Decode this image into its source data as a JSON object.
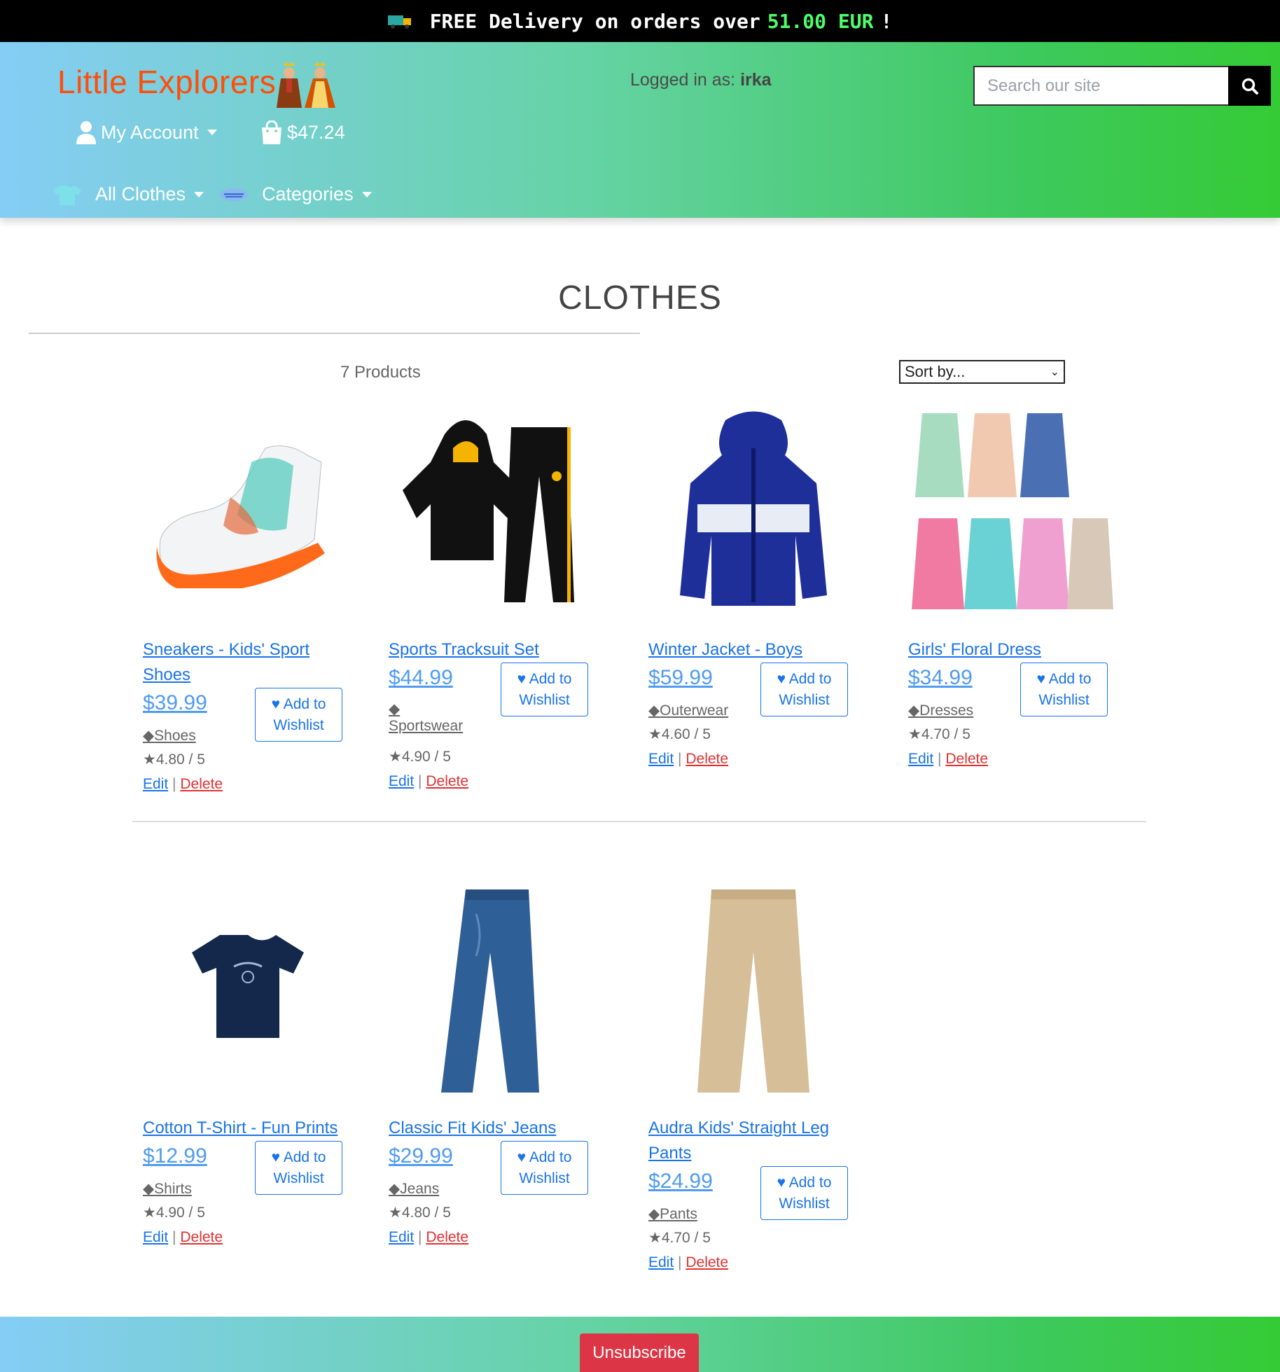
{
  "banner": {
    "prefix": "FREE Delivery on orders over",
    "amount": "51.00 EUR",
    "suffix": "!",
    "icon": "truck-icon"
  },
  "header": {
    "brand": "Little Explorers",
    "logged_in_label": "Logged in as:",
    "username": "irka",
    "search_placeholder": "Search our site",
    "account_label": "My Account",
    "cart_total": "$47.24",
    "nav": {
      "all_clothes": "All Clothes",
      "categories": "Categories"
    }
  },
  "main": {
    "title": "CLOTHES",
    "product_count": "7 Products",
    "sort_label": "Sort by..."
  },
  "wishlist_label_line1": "Add to",
  "wishlist_label_line2": "Wishlist",
  "edit_label": "Edit",
  "delete_label": "Delete",
  "separator": "|",
  "products": [
    {
      "name": "Sneakers - Kids' Sport Shoes",
      "price": "$39.99",
      "category": "Shoes",
      "rating": "4.80 / 5"
    },
    {
      "name": "Sports Tracksuit Set",
      "price": "$44.99",
      "category": "Sportswear",
      "rating": "4.90 / 5"
    },
    {
      "name": "Winter Jacket - Boys",
      "price": "$59.99",
      "category": "Outerwear",
      "rating": "4.60 / 5"
    },
    {
      "name": "Girls' Floral Dress",
      "price": "$34.99",
      "category": "Dresses",
      "rating": "4.70 / 5"
    },
    {
      "name": "Cotton T-Shirt - Fun Prints",
      "price": "$12.99",
      "category": "Shirts",
      "rating": "4.90 / 5"
    },
    {
      "name": "Classic Fit Kids' Jeans",
      "price": "$29.99",
      "category": "Jeans",
      "rating": "4.80 / 5"
    },
    {
      "name": "Audra Kids' Straight Leg Pants",
      "price": "$24.99",
      "category": "Pants",
      "rating": "4.70 / 5"
    }
  ],
  "footer": {
    "unsubscribe_label": "Unsubscribe"
  },
  "colors": {
    "brand": "#ff4d0a",
    "link": "#1a73e8",
    "delete": "#e03131",
    "free_amount": "#4dff6a",
    "unsubscribe": "#dc3545"
  }
}
